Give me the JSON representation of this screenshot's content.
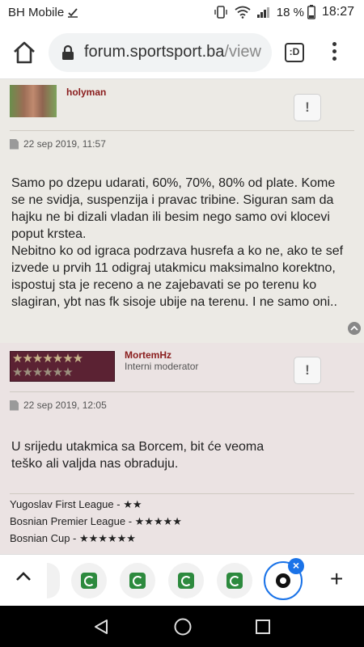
{
  "status_bar": {
    "carrier": "BH Mobile",
    "battery": "18 %",
    "time": "18:27"
  },
  "browser": {
    "url_main": "forum.sportsport.ba",
    "url_dim": "/view",
    "tabs_label": ":D"
  },
  "posts": [
    {
      "author": "holyman",
      "date": "22 sep 2019, 11:57",
      "report_label": "!",
      "body": [
        "Samo po dzepu udarati, 60%, 70%, 80% od plate. Kome se ne svidja, suspenzija i pravac tribine. Siguran sam da hajku ne bi dizali vladan ili besim nego samo ovi klocevi poput krstea.",
        "Nebitno ko od igraca podrzava husrefa a ko ne, ako te sef izvede u prvih 11 odigraj utakmicu maksimalno korektno, ispostuj sta je receno a ne zajebavati se po terenu ko slagiran, ybt nas fk sisoje ubije na terenu. I ne samo oni.."
      ]
    },
    {
      "author": "MortemHz",
      "rank": "Interni moderator",
      "date": "22 sep 2019, 12:05",
      "report_label": "!",
      "body": [
        "U srijedu utakmica sa Borcem, bit će veoma teško ali valjda nas obraduju."
      ],
      "signature": [
        "Yugoslav First League - ★★",
        "Bosnian Premier League - ★★★★★",
        "Bosnian Cup - ★★★★★★"
      ]
    }
  ],
  "bottom_nav": {
    "plus": "+",
    "close": "×"
  }
}
